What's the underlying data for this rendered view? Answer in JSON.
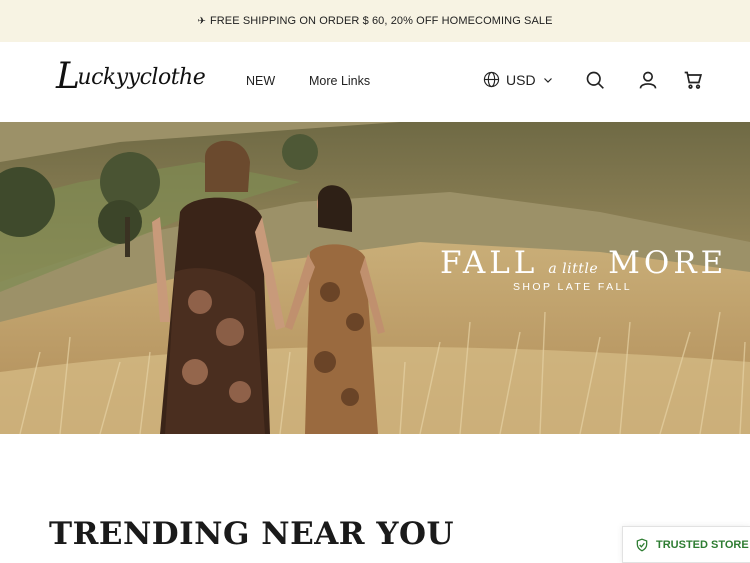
{
  "announcement": {
    "icon": "airplane-icon",
    "text": "FREE SHIPPING ON ORDER $ 60, 20% OFF HOMECOMING SALE"
  },
  "header": {
    "logo_first": "L",
    "logo_rest": "uckyyclothe",
    "nav": [
      {
        "label": "NEW"
      },
      {
        "label": "More Links"
      }
    ],
    "currency": "USD",
    "icons": [
      "globe-icon",
      "chevron-down-icon",
      "search-icon",
      "user-icon",
      "cart-icon"
    ]
  },
  "hero": {
    "title_left": "FALL",
    "title_middle": "a little",
    "title_right": "MORE",
    "subtitle": "SHOP LATE FALL"
  },
  "section": {
    "title": "TRENDING NEAR YOU"
  },
  "badge": {
    "label": "TRUSTED STORE",
    "color": "#2e7d32"
  },
  "colors": {
    "announcement_bg": "#f7f3e3",
    "text": "#1a1a1a"
  }
}
